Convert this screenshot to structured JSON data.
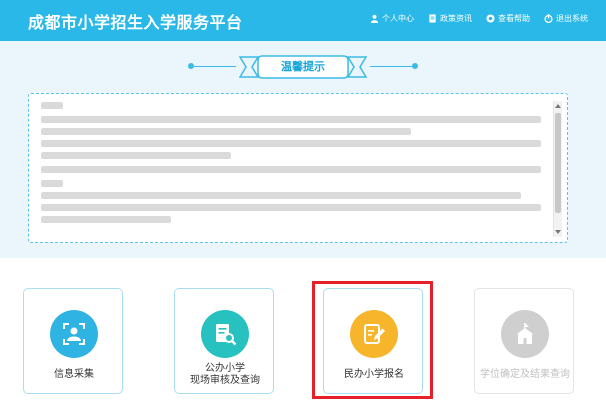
{
  "header": {
    "title": "成都市小学招生入学服务平台",
    "nav": [
      {
        "label": "个人中心",
        "icon": "user-icon"
      },
      {
        "label": "政策资讯",
        "icon": "document-icon"
      },
      {
        "label": "查看帮助",
        "icon": "help-icon"
      },
      {
        "label": "退出系统",
        "icon": "power-icon"
      }
    ]
  },
  "notice": {
    "title": "温馨提示"
  },
  "cards": [
    {
      "label": "信息采集",
      "icon": "user-scan-icon",
      "color": "#2fb3e3",
      "enabled": true
    },
    {
      "label": "公办小学\n现场审核及查询",
      "icon": "document-search-icon",
      "color": "#27c1c0",
      "enabled": true
    },
    {
      "label": "民办小学报名",
      "icon": "edit-document-icon",
      "color": "#f7b52c",
      "enabled": true
    },
    {
      "label": "学位确定及结果查询",
      "icon": "school-icon",
      "color": "#cfcfcf",
      "enabled": false
    }
  ],
  "colors": {
    "header": "#29b8e8",
    "accent": "#3dbbe4",
    "highlight": "#e5202a"
  }
}
